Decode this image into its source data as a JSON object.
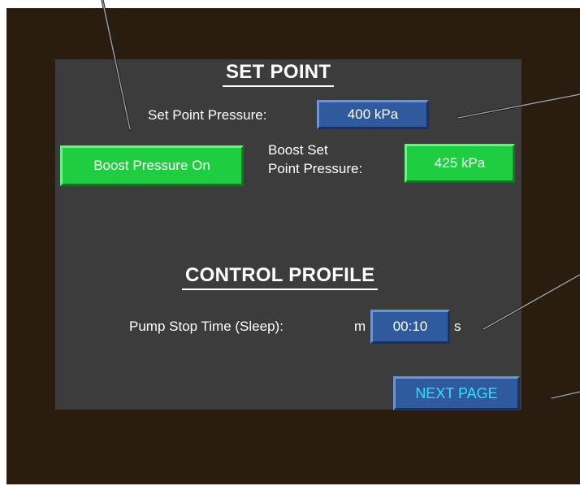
{
  "set_point": {
    "title": "SET POINT",
    "pressure_label": "Set Point Pressure:",
    "pressure_value": "400 kPa",
    "boost_button": "Boost Pressure On",
    "boost_label_line1": "Boost Set",
    "boost_label_line2": "Point Pressure:",
    "boost_value": "425 kPa"
  },
  "control_profile": {
    "title": "CONTROL PROFILE",
    "stop_time_label": "Pump Stop Time (Sleep):",
    "stop_time_prefix": "m",
    "stop_time_value": "00:10",
    "stop_time_unit": "s"
  },
  "navigation": {
    "next_page": "NEXT PAGE"
  },
  "colors": {
    "frame": "#2a1d10",
    "panel": "#3c3c3c",
    "blue_button": "#2f5a9e",
    "green_button": "#1ece40",
    "next_text": "#2ee0ff"
  }
}
